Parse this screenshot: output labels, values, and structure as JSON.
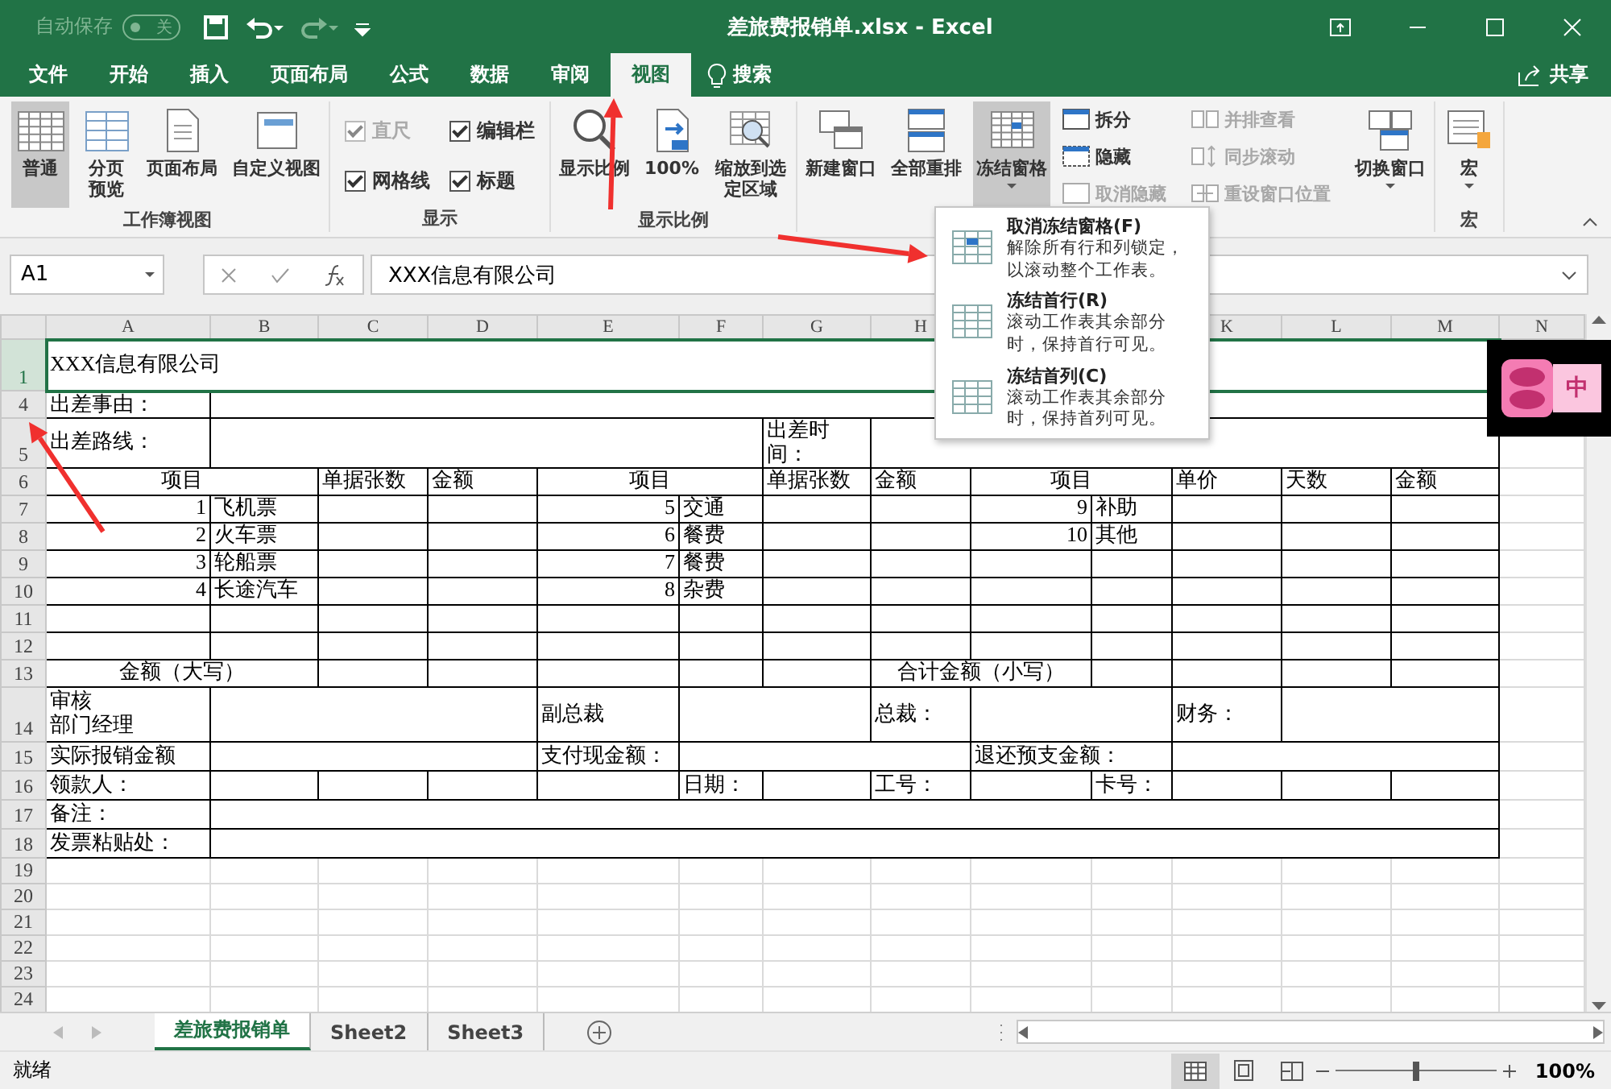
{
  "title_bar": {
    "autosave_label": "自动保存",
    "autosave": {
      "on": false,
      "label": "关"
    },
    "title": "差旅费报销单.xlsx  -  Excel"
  },
  "tabs": [
    {
      "label": "文件",
      "selected": false
    },
    {
      "label": "开始",
      "selected": false
    },
    {
      "label": "插入",
      "selected": false
    },
    {
      "label": "页面布局",
      "selected": false
    },
    {
      "label": "公式",
      "selected": false
    },
    {
      "label": "数据",
      "selected": false
    },
    {
      "label": "审阅",
      "selected": false
    },
    {
      "label": "视图",
      "selected": true
    }
  ],
  "search": {
    "label": "搜索"
  },
  "share": {
    "label": "共享"
  },
  "ribbon": {
    "groups": [
      {
        "label": "工作簿视图",
        "kind": "big",
        "items": [
          {
            "label": "普通",
            "selected": true,
            "dropdown": false
          },
          {
            "label": "分页预览",
            "selected": false,
            "dropdown": false
          },
          {
            "label": "页面布局",
            "selected": false,
            "dropdown": false
          },
          {
            "label": "自定义视图",
            "selected": false,
            "dropdown": false
          }
        ]
      },
      {
        "label": "显示",
        "kind": "checks",
        "items": [
          {
            "label": "直尺",
            "checked": true,
            "disabled": true
          },
          {
            "label": "编辑栏",
            "checked": true,
            "disabled": false
          },
          {
            "label": "网格线",
            "checked": true,
            "disabled": false
          },
          {
            "label": "标题",
            "checked": true,
            "disabled": false
          }
        ]
      },
      {
        "label": "显示比例",
        "kind": "big",
        "items": [
          {
            "label": "显示比例",
            "selected": false,
            "dropdown": false
          },
          {
            "label": "100%",
            "selected": false,
            "dropdown": false
          },
          {
            "label": "缩放到选定区域",
            "selected": false,
            "dropdown": false
          }
        ]
      },
      {
        "kind": "window",
        "items": [
          {
            "kind": "big",
            "label": "新建窗口",
            "selected": false,
            "dropdown": false
          },
          {
            "kind": "big",
            "label": "全部重排",
            "selected": false,
            "dropdown": false
          },
          {
            "kind": "big",
            "label": "冻结窗格",
            "selected": true,
            "dropdown": true
          },
          {
            "kind": "stack",
            "items": [
              {
                "label": "拆分",
                "disabled": false
              },
              {
                "label": "隐藏",
                "disabled": false
              },
              {
                "label": "取消隐藏",
                "disabled": true
              }
            ]
          },
          {
            "kind": "stack",
            "items": [
              {
                "label": "并排查看",
                "disabled": true
              },
              {
                "label": "同步滚动",
                "disabled": true
              },
              {
                "label": "重设窗口位置",
                "disabled": true
              }
            ]
          },
          {
            "kind": "big",
            "label": "切换窗口",
            "selected": false,
            "dropdown": true
          }
        ]
      },
      {
        "label": "宏",
        "kind": "big",
        "items": [
          {
            "label": "宏",
            "selected": false,
            "dropdown": true
          }
        ]
      }
    ]
  },
  "freeze_menu": {
    "items": [
      {
        "title": "取消冻结窗格(F)",
        "description": "解除所有行和列锁定，以滚动整个工作表。"
      },
      {
        "title": "冻结首行(R)",
        "description": "滚动工作表其余部分时，保持首行可见。"
      },
      {
        "title": "冻结首列(C)",
        "description": "滚动工作表其余部分时，保持首列可见。"
      }
    ]
  },
  "formula_bar": {
    "name_box": "A1",
    "value": "XXX信息有限公司"
  },
  "sheet": {
    "column_headers": [
      "A",
      "B",
      "C",
      "D",
      "E",
      "F",
      "G",
      "H",
      "K",
      "L",
      "M",
      "N"
    ],
    "rows": [
      {
        "header": "1",
        "kind": "title",
        "cells": [
          {
            "text": "XXX信息有限公司",
            "selected": true
          }
        ]
      },
      {
        "header": "4",
        "kind": "form",
        "cells": [
          {
            "text": "出差事由："
          },
          {}
        ]
      },
      {
        "header": "5",
        "kind": "form",
        "cells": [
          {
            "text": "出差路线："
          },
          {},
          {
            "text": "出差时间："
          },
          {}
        ]
      },
      {
        "header": "6",
        "kind": "form",
        "cells": [
          {
            "text": "项目",
            "kind": "heading"
          },
          {
            "text": "单据张数"
          },
          {
            "text": "金额"
          },
          {
            "text": "项目",
            "kind": "heading"
          },
          {
            "text": "单据张数"
          },
          {
            "text": "金额"
          },
          {
            "text": "项目",
            "kind": "heading"
          },
          {
            "text": "单价"
          },
          {
            "text": "天数"
          },
          {
            "text": "金额"
          }
        ]
      },
      {
        "header": "7",
        "kind": "form",
        "cells": [
          {
            "text": "1",
            "kind": "number"
          },
          {
            "text": "飞机票"
          },
          {},
          {},
          {
            "text": "5",
            "kind": "number"
          },
          {
            "text": "交通"
          },
          {},
          {},
          {
            "text": "9",
            "kind": "number"
          },
          {
            "text": "补助"
          },
          {},
          {},
          {}
        ]
      },
      {
        "header": "8",
        "kind": "form",
        "cells": [
          {
            "text": "2",
            "kind": "number"
          },
          {
            "text": "火车票"
          },
          {},
          {},
          {
            "text": "6",
            "kind": "number"
          },
          {
            "text": "餐费"
          },
          {},
          {},
          {
            "text": "10",
            "kind": "number"
          },
          {
            "text": "其他"
          },
          {},
          {},
          {}
        ]
      },
      {
        "header": "9",
        "kind": "form",
        "cells": [
          {
            "text": "3",
            "kind": "number"
          },
          {
            "text": "轮船票"
          },
          {},
          {},
          {
            "text": "7",
            "kind": "number"
          },
          {
            "text": "餐费"
          },
          {},
          {},
          {},
          {},
          {},
          {},
          {}
        ]
      },
      {
        "header": "10",
        "kind": "form",
        "cells": [
          {
            "text": "4",
            "kind": "number"
          },
          {
            "text": "长途汽车"
          },
          {},
          {},
          {
            "text": "8",
            "kind": "number"
          },
          {
            "text": "杂费"
          },
          {},
          {},
          {},
          {},
          {},
          {},
          {}
        ]
      },
      {
        "header": "11",
        "kind": "form"
      },
      {
        "header": "12",
        "kind": "form"
      },
      {
        "header": "13",
        "kind": "form",
        "cells": [
          {
            "text": "金额（大写）",
            "kind": "heading"
          },
          {},
          {},
          {},
          {},
          {},
          {
            "text": "合计金额（小写）",
            "kind": "heading"
          },
          {},
          {},
          {},
          {}
        ]
      },
      {
        "header": "14",
        "kind": "form",
        "cells": [
          {
            "lines": [
              "审核",
              "部门经理"
            ]
          },
          {},
          {
            "text": "副总裁"
          },
          {},
          {
            "text": "总裁："
          },
          {},
          {
            "text": "财务："
          },
          {}
        ]
      },
      {
        "header": "15",
        "kind": "form",
        "cells": [
          {
            "text": "实际报销金额"
          },
          {},
          {
            "text": "支付现金额："
          },
          {},
          {
            "text": "退还预支金额："
          },
          {}
        ]
      },
      {
        "header": "16",
        "kind": "form",
        "cells": [
          {
            "text": "领款人："
          },
          {},
          {},
          {},
          {},
          {
            "text": "日期："
          },
          {},
          {
            "text": "工号："
          },
          {},
          {
            "text": "卡号："
          },
          {},
          {},
          {}
        ]
      },
      {
        "header": "17",
        "kind": "form",
        "cells": [
          {
            "text": "备注："
          },
          {}
        ]
      },
      {
        "header": "18",
        "kind": "form",
        "cells": [
          {
            "text": "发票粘贴处："
          },
          {}
        ]
      },
      {
        "header": "19",
        "kind": "blank"
      },
      {
        "header": "20",
        "kind": "blank"
      },
      {
        "header": "21",
        "kind": "blank"
      },
      {
        "header": "22",
        "kind": "blank"
      },
      {
        "header": "23",
        "kind": "blank"
      },
      {
        "header": "24",
        "kind": "blank"
      }
    ]
  },
  "sheet_tabs": [
    {
      "label": "差旅费报销单",
      "selected": true
    },
    {
      "label": "Sheet2",
      "selected": false
    },
    {
      "label": "Sheet3",
      "selected": false
    }
  ],
  "status_bar": {
    "status": "就绪",
    "views": [
      {
        "selected": true
      },
      {
        "selected": false
      },
      {
        "selected": false
      }
    ],
    "zoom": {
      "level": 0.5,
      "reading": "100%"
    }
  },
  "ime_widget": {
    "label": "中"
  }
}
